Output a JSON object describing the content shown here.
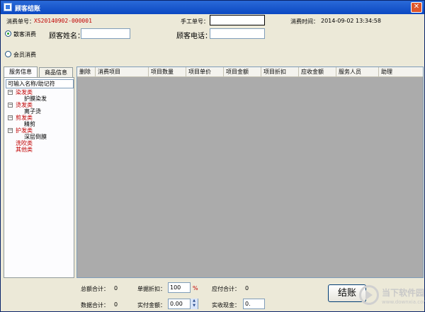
{
  "window": {
    "title": "顾客结账",
    "close_glyph": "✕"
  },
  "form": {
    "order_no_label": "消费单号：",
    "order_no_value": "XS20140902-000001",
    "manual_no_label": "手工单号：",
    "manual_no_value": "",
    "time_label": "消费时间：",
    "time_value": "2014-09-02 13:34:58",
    "walkin_label": "散客消费",
    "customer_name_label": "顾客姓名：",
    "customer_name_value": "",
    "customer_phone_label": "顾客电话：",
    "customer_phone_value": "",
    "member_label": "会员消费"
  },
  "tabs": [
    {
      "label": "服务信息"
    },
    {
      "label": "商品信息"
    }
  ],
  "left_panel": {
    "search_placeholder": "可输入名称/助记符",
    "tree": [
      {
        "label": "染发类",
        "expander": "−",
        "children": [
          "护膜染发"
        ]
      },
      {
        "label": "烫发类",
        "expander": "−",
        "children": [
          "离子烫"
        ]
      },
      {
        "label": "剪发类",
        "expander": "−",
        "children": [
          "精剪"
        ]
      },
      {
        "label": "护发类",
        "expander": "−",
        "children": [
          "深层倒膜"
        ]
      },
      {
        "label": "洗吹类",
        "expander": "",
        "children": []
      },
      {
        "label": "其他类",
        "expander": "",
        "children": []
      }
    ]
  },
  "grid": {
    "columns": [
      "删除",
      "消费项目",
      "项目数量",
      "项目单价",
      "项目金额",
      "项目折扣",
      "应收金额",
      "服务人员",
      "助理"
    ]
  },
  "summary": {
    "total_qty_label": "总额合计：",
    "total_qty_value": "0",
    "discount_label": "单据折扣：",
    "discount_value": "100",
    "discount_unit": "%",
    "payable_label": "应付合计：",
    "payable_value": "0",
    "data_total_label": "数据合计：",
    "data_total_value": "0",
    "actual_label": "实付金额：",
    "actual_value": "0.00",
    "cash_label": "实收现金：",
    "cash_value": "0."
  },
  "buttons": {
    "checkout_label": "结账"
  },
  "watermark": {
    "name": "当下软件园",
    "url": "www.downxia.com"
  },
  "colors": {
    "accent_red": "#c00000",
    "titlebar": "#0b48c2"
  }
}
